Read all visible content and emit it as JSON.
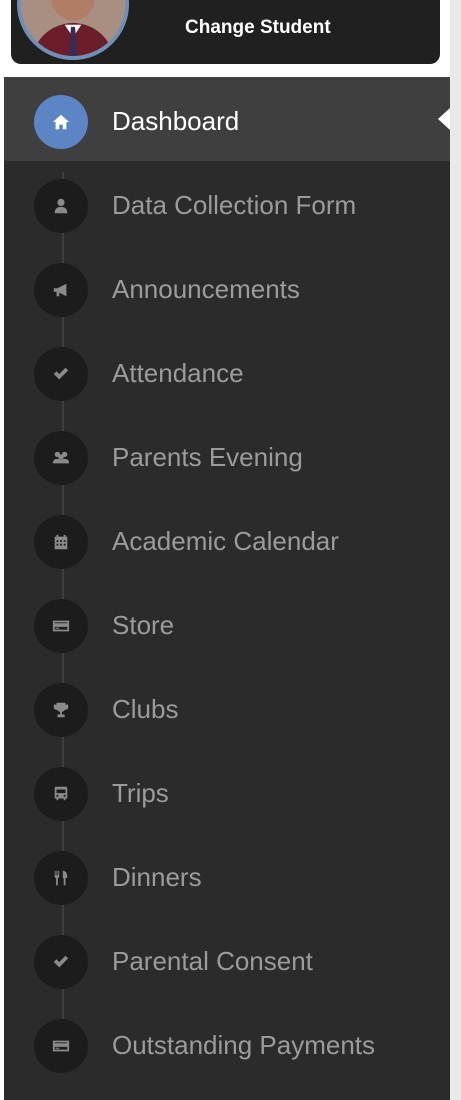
{
  "profile": {
    "change_student_label": "Change Student"
  },
  "sidebar": {
    "items": [
      {
        "label": "Dashboard",
        "icon": "home-icon",
        "active": true
      },
      {
        "label": "Data Collection Form",
        "icon": "user-icon",
        "active": false
      },
      {
        "label": "Announcements",
        "icon": "megaphone-icon",
        "active": false
      },
      {
        "label": "Attendance",
        "icon": "check-icon",
        "active": false
      },
      {
        "label": "Parents Evening",
        "icon": "users-icon",
        "active": false
      },
      {
        "label": "Academic Calendar",
        "icon": "calendar-icon",
        "active": false
      },
      {
        "label": "Store",
        "icon": "credit-card-icon",
        "active": false
      },
      {
        "label": "Clubs",
        "icon": "trophy-icon",
        "active": false
      },
      {
        "label": "Trips",
        "icon": "bus-icon",
        "active": false
      },
      {
        "label": "Dinners",
        "icon": "cutlery-icon",
        "active": false
      },
      {
        "label": "Parental Consent",
        "icon": "check-icon",
        "active": false
      },
      {
        "label": "Outstanding Payments",
        "icon": "credit-card-icon",
        "active": false
      }
    ]
  },
  "colors": {
    "sidebar_bg": "#2b2b2b",
    "active_bg": "#3f3f3f",
    "active_icon_bg": "#5b85c5",
    "inactive_text": "#9b9b9b"
  }
}
